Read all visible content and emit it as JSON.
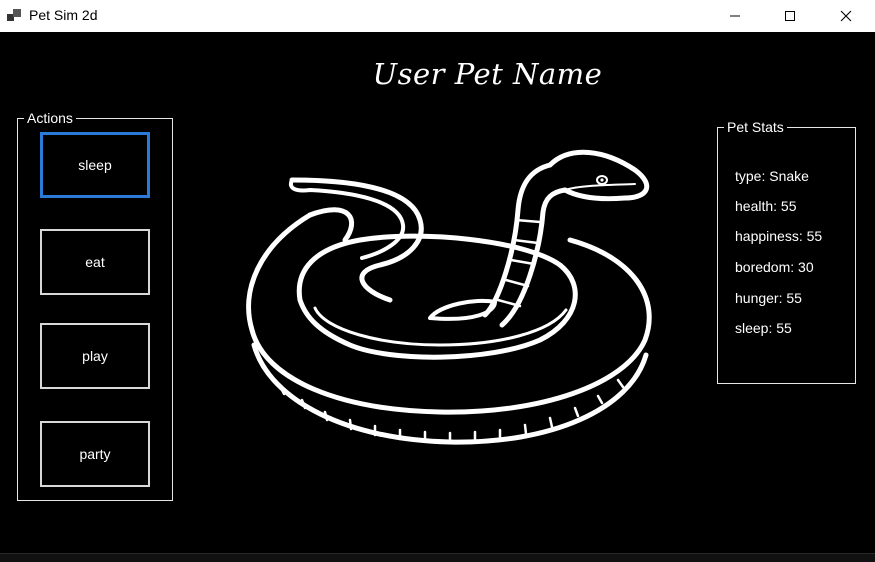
{
  "window": {
    "title": "Pet Sim 2d",
    "icon": "app-window-icon",
    "controls": {
      "minimize": "minimize-icon",
      "maximize": "maximize-icon",
      "close": "close-icon"
    }
  },
  "header": {
    "pet_name": "User Pet Name"
  },
  "actions": {
    "legend": "Actions",
    "buttons": [
      "sleep",
      "eat",
      "play",
      "party"
    ]
  },
  "stats": {
    "legend": "Pet Stats",
    "type": "type: Snake",
    "health": "health: 55",
    "happiness": "happiness: 55",
    "boredom": "boredom: 30",
    "hunger": "hunger: 55",
    "sleep": "sleep: 55"
  },
  "pet_image": {
    "icon": "snake-image"
  },
  "colors": {
    "background": "#000000",
    "titlebar": "#ffffff",
    "text": "#ffffff",
    "focus_border": "#2b7ad8",
    "button_border": "#d8d8d8"
  }
}
